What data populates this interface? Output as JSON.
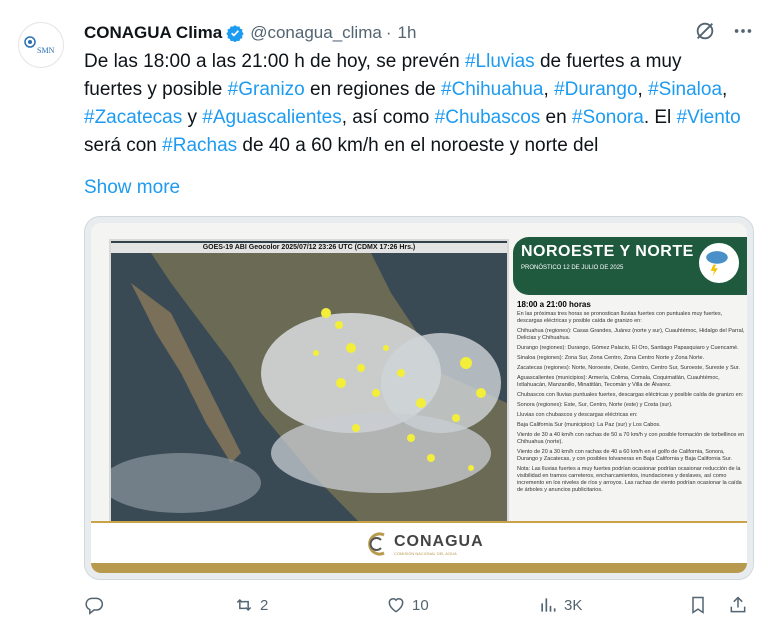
{
  "avatar": {
    "label": "SMN"
  },
  "header": {
    "name": "CONAGUA Clima",
    "handle": "@conagua_clima",
    "separator": "·",
    "time": "1h"
  },
  "tweet": {
    "segments": [
      {
        "text": "De las 18:00 a las 21:00 h de hoy, se prevén ",
        "tag": false
      },
      {
        "text": "#Lluvias",
        "tag": true
      },
      {
        "text": " de fuertes a muy fuertes y posible ",
        "tag": false
      },
      {
        "text": "#Granizo",
        "tag": true
      },
      {
        "text": " en regiones de ",
        "tag": false
      },
      {
        "text": "#Chihuahua",
        "tag": true
      },
      {
        "text": ", ",
        "tag": false
      },
      {
        "text": "#Durango",
        "tag": true
      },
      {
        "text": ", ",
        "tag": false
      },
      {
        "text": "#Sinaloa",
        "tag": true
      },
      {
        "text": ", ",
        "tag": false
      },
      {
        "text": "#Zacatecas",
        "tag": true
      },
      {
        "text": " y ",
        "tag": false
      },
      {
        "text": "#Aguascalientes",
        "tag": true
      },
      {
        "text": ", así como ",
        "tag": false
      },
      {
        "text": "#Chubascos",
        "tag": true
      },
      {
        "text": " en ",
        "tag": false
      },
      {
        "text": "#Sonora",
        "tag": true
      },
      {
        "text": ". El ",
        "tag": false
      },
      {
        "text": "#Viento",
        "tag": true
      },
      {
        "text": " será con ",
        "tag": false
      },
      {
        "text": "#Rachas",
        "tag": true
      },
      {
        "text": " de 40 a 60 km/h en el noroeste y norte del",
        "tag": false
      }
    ],
    "show_more": "Show more"
  },
  "media": {
    "map_title": "GOES-19 ABI Geocolor 2025/07/12 23:26 UTC (CDMX 17:26 Hrs.)",
    "panel_title": "NOROESTE Y NORTE",
    "panel_subtitle": "PRONÓSTICO 12 DE JULIO DE 2025",
    "time_range": "18:00 a 21:00 horas",
    "intro": "En las próximas tres horas se pronostican lluvias fuertes con puntuales muy fuertes, descargas eléctricas y posible caída de granizo en:",
    "chihuahua": "Chihuahua (regiones): Casas Grandes, Juárez (norte y sur), Cuauhtémoc, Hidalgo del Parral, Delicias y Chihuahua.",
    "durango": "Durango (regiones): Durango, Gómez Palacio, El Oro, Santiago Papasquiaro y Cuencamé.",
    "sinaloa": "Sinaloa (regiones): Zona Sur, Zona Centro, Zona Centro Norte y Zona Norte.",
    "zacatecas": "Zacatecas (regiones): Norte, Noroeste, Oeste, Centro, Centro Sur, Suroeste, Sureste y Sur.",
    "aguascalientes": "Aguascalientes (municipios): Armería, Colima, Comala, Coquimatlán, Cuauhtémoc, Ixtlahuacán, Manzanillo, Minatitlán, Tecomán y Villa de Álvarez.",
    "chubascos": "Chubascos con lluvias puntuales fuertes, descargas eléctricas y posible caída de granizo en:",
    "sonora": "Sonora (regiones): Este, Sur, Centro, Norte (este) y Costa (sur).",
    "lluvias": "Lluvias con chubascos y descargas eléctricas en:",
    "bcs": "Baja California Sur (municipios): La Paz (sur) y Los Cabos.",
    "viento1": "Viento de 30 a 40 km/h con rachas de 50 a 70 km/h y con posible formación de torbellinos en Chihuahua (norte).",
    "viento2": "Viento de 20 a 30 km/h con rachas de 40 a 60 km/h en el golfo de California, Sonora, Durango y Zacatecas, y con posibles tolvaneras en Baja California y Baja California Sur.",
    "nota": "Nota: Las lluvias fuertes a muy fuertes podrían ocasionar podrían ocasionar reducción de la visibilidad en tramos carreteros, encharcamientos, inundaciones y deslaves, así como incremento en los niveles de ríos y arroyos. Las rachas de viento podrían ocasionar la caída de árboles y anuncios publicitarios.",
    "logo_word": "CONAGUA",
    "logo_sub": "COMISIÓN NACIONAL DEL AGUA"
  },
  "actions": {
    "replies": "",
    "retweets": "2",
    "likes": "10",
    "views": "3K"
  },
  "colors": {
    "accent": "#1d9bf0",
    "panel_green": "#1f5a3f",
    "gold": "#b89a4f"
  }
}
